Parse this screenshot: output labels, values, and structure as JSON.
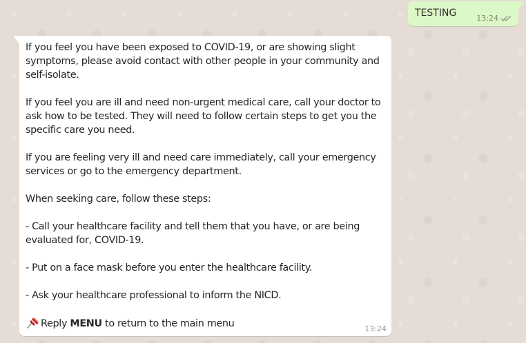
{
  "chat": {
    "outgoing": {
      "text": "TESTING",
      "time": "13:24",
      "status_icon": "double-check-icon"
    },
    "incoming": {
      "paragraphs": [
        "If you feel you have been exposed to COVID-19, or are showing slight symptoms, please avoid contact with other people in your community and self-isolate.",
        "If you feel you are ill and need non-urgent medical care, call your doctor to ask how to be tested. They will need to follow certain steps to get you the specific care you need.",
        "If you are feeling very ill and need care immediately, call your emergency services or go to the emergency department.",
        "When seeking care, follow these steps:",
        "- Call your healthcare facility and tell them that you have, or are being evaluated for, COVID-19.",
        "- Put on a face mask before you enter the healthcare facility.",
        "- Ask your healthcare professional to inform the NICD."
      ],
      "footer": {
        "icon": "pushpin-icon",
        "prefix": "Reply ",
        "keyword": "MENU",
        "suffix": " to return to the main menu"
      },
      "time": "13:24"
    }
  },
  "colors": {
    "wallpaper": "#e5ddd5",
    "outgoing_bubble": "#dcf8c6",
    "incoming_bubble": "#ffffff",
    "pin_red": "#d0332b"
  }
}
